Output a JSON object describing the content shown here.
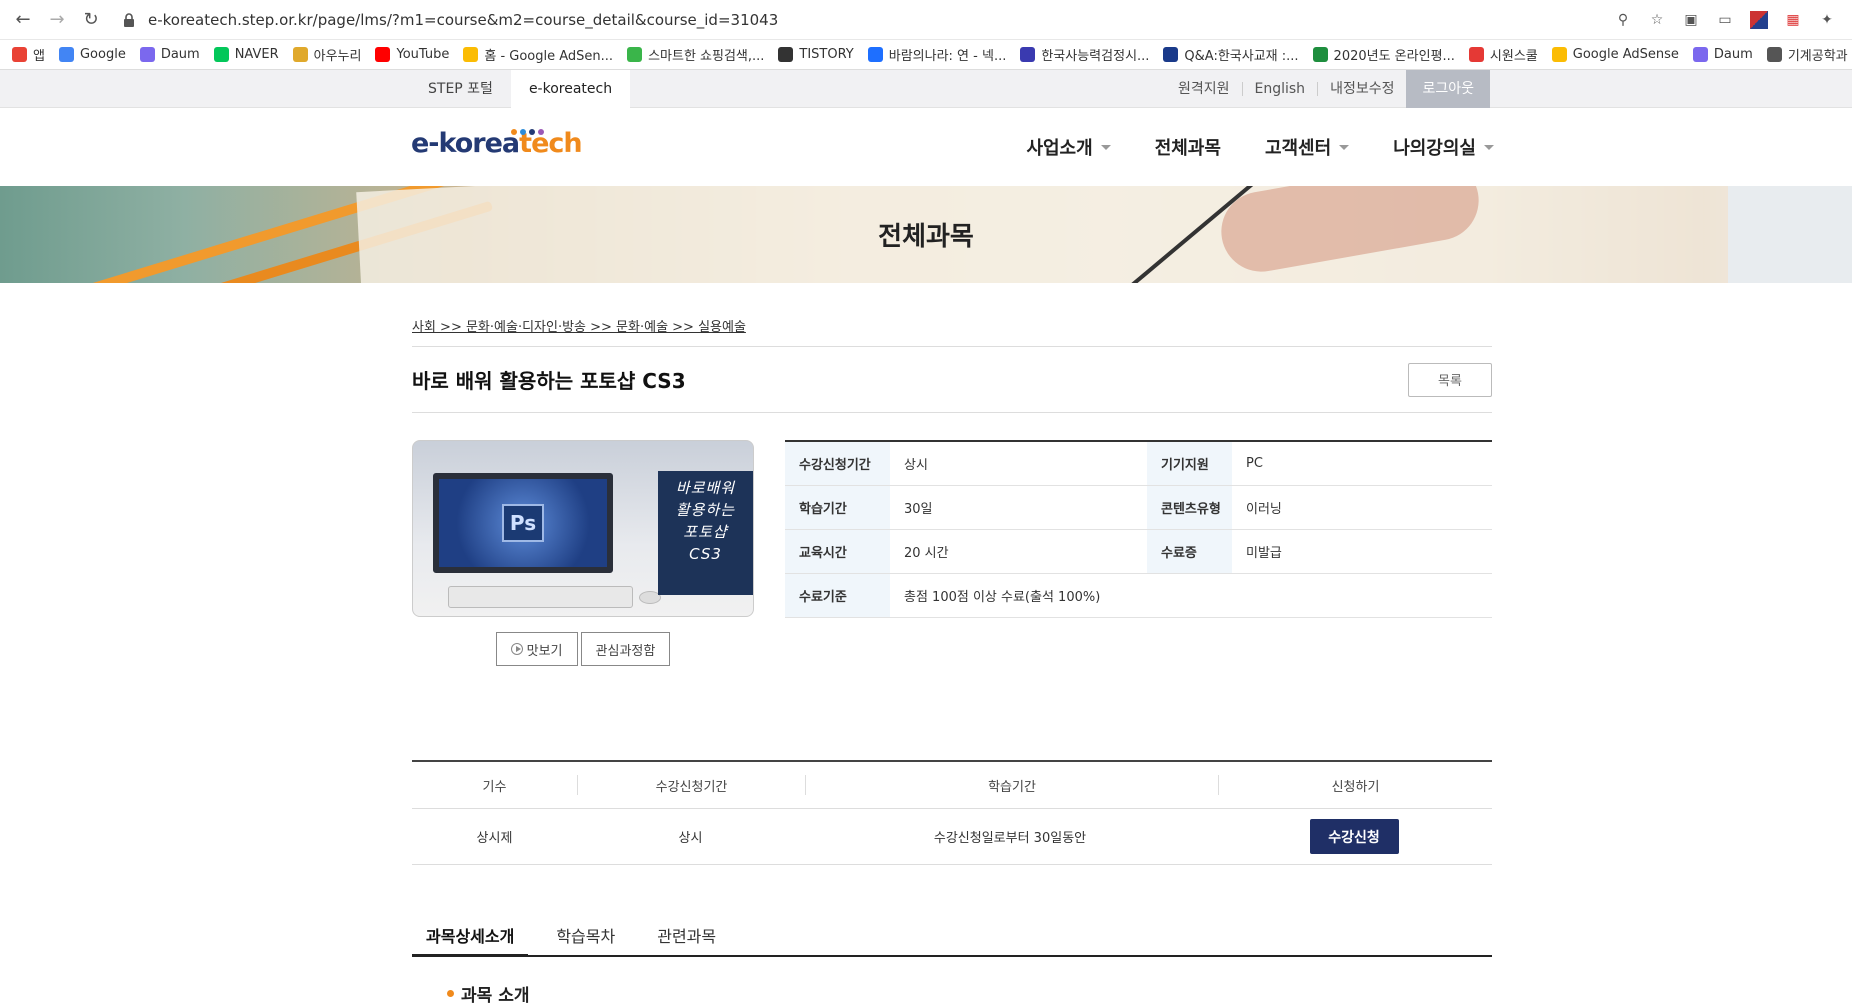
{
  "browser": {
    "url": "e-koreatech.step.or.kr/page/lms/?m1=course&m2=course_detail&course_id=31043",
    "bookmarks": [
      {
        "label": "앱",
        "color": "#e94235"
      },
      {
        "label": "Google",
        "color": "#4285f4"
      },
      {
        "label": "Daum",
        "color": "#7b68ee"
      },
      {
        "label": "NAVER",
        "color": "#03c75a"
      },
      {
        "label": "아우누리",
        "color": "#e0a92c"
      },
      {
        "label": "YouTube",
        "color": "#ff0000"
      },
      {
        "label": "홈 - Google AdSen...",
        "color": "#fbbc04"
      },
      {
        "label": "스마트한 쇼핑검색,...",
        "color": "#3ab54a"
      },
      {
        "label": "TISTORY",
        "color": "#333333"
      },
      {
        "label": "바람의나라: 연 - 넥...",
        "color": "#1e6fff"
      },
      {
        "label": "한국사능력검정시...",
        "color": "#3a3ab0"
      },
      {
        "label": "Q&A:한국사교재 :...",
        "color": "#1a3a8a"
      },
      {
        "label": "2020년도 온라인평...",
        "color": "#1e8e3e"
      },
      {
        "label": "시원스쿨",
        "color": "#e53935"
      },
      {
        "label": "Google AdSense",
        "color": "#fbbc04"
      },
      {
        "label": "Daum",
        "color": "#7b68ee"
      },
      {
        "label": "기계공학과",
        "color": "#555555"
      }
    ]
  },
  "topbar": {
    "tabs": [
      "STEP 포털",
      "e-koreatech"
    ],
    "links": [
      "원격지원",
      "English",
      "내정보수정"
    ],
    "logout": "로그아웃"
  },
  "header": {
    "logo_main": "e-korea",
    "logo_accent": "tech",
    "logo_dot_colors": [
      "#f08a1c",
      "#2d8bd8",
      "#243a74",
      "#9b59b6"
    ],
    "nav": [
      "사업소개",
      "전체과목",
      "고객센터",
      "나의강의실"
    ]
  },
  "banner": {
    "title": "전체과목"
  },
  "course": {
    "breadcrumb": "사회 >> 문화·예술·디자인·방송 >> 문화·예술 >> 실용예술",
    "title": "바로 배워 활용하는 포토샵 CS3",
    "list_button": "목록",
    "thumbnail_logo": "Ps",
    "thumbnail_text": [
      "바로배워",
      "활용하는",
      "포토샵",
      "CS3"
    ],
    "preview_button": "맛보기",
    "interest_button": "관심과정함",
    "info": {
      "apply_period_label": "수강신청기간",
      "apply_period": "상시",
      "device_label": "기기지원",
      "device": "PC",
      "study_period_label": "학습기간",
      "study_period": "30일",
      "content_type_label": "콘텐츠유형",
      "content_type": "이러닝",
      "edu_hours_label": "교육시간",
      "edu_hours": "20 시간",
      "certificate_label": "수료증",
      "certificate": "미발급",
      "criteria_label": "수료기준",
      "criteria": "총점 100점 이상 수료(출석 100%)"
    }
  },
  "schedule": {
    "headers": [
      "기수",
      "수강신청기간",
      "학습기간",
      "신청하기"
    ],
    "rows": [
      {
        "term": "상시제",
        "apply_period": "상시",
        "study_period": "수강신청일로부터 30일동안",
        "action": "수강신청"
      }
    ]
  },
  "tabs": [
    "과목상세소개",
    "학습목차",
    "관련과목"
  ],
  "section": {
    "heading": "과목 소개"
  }
}
